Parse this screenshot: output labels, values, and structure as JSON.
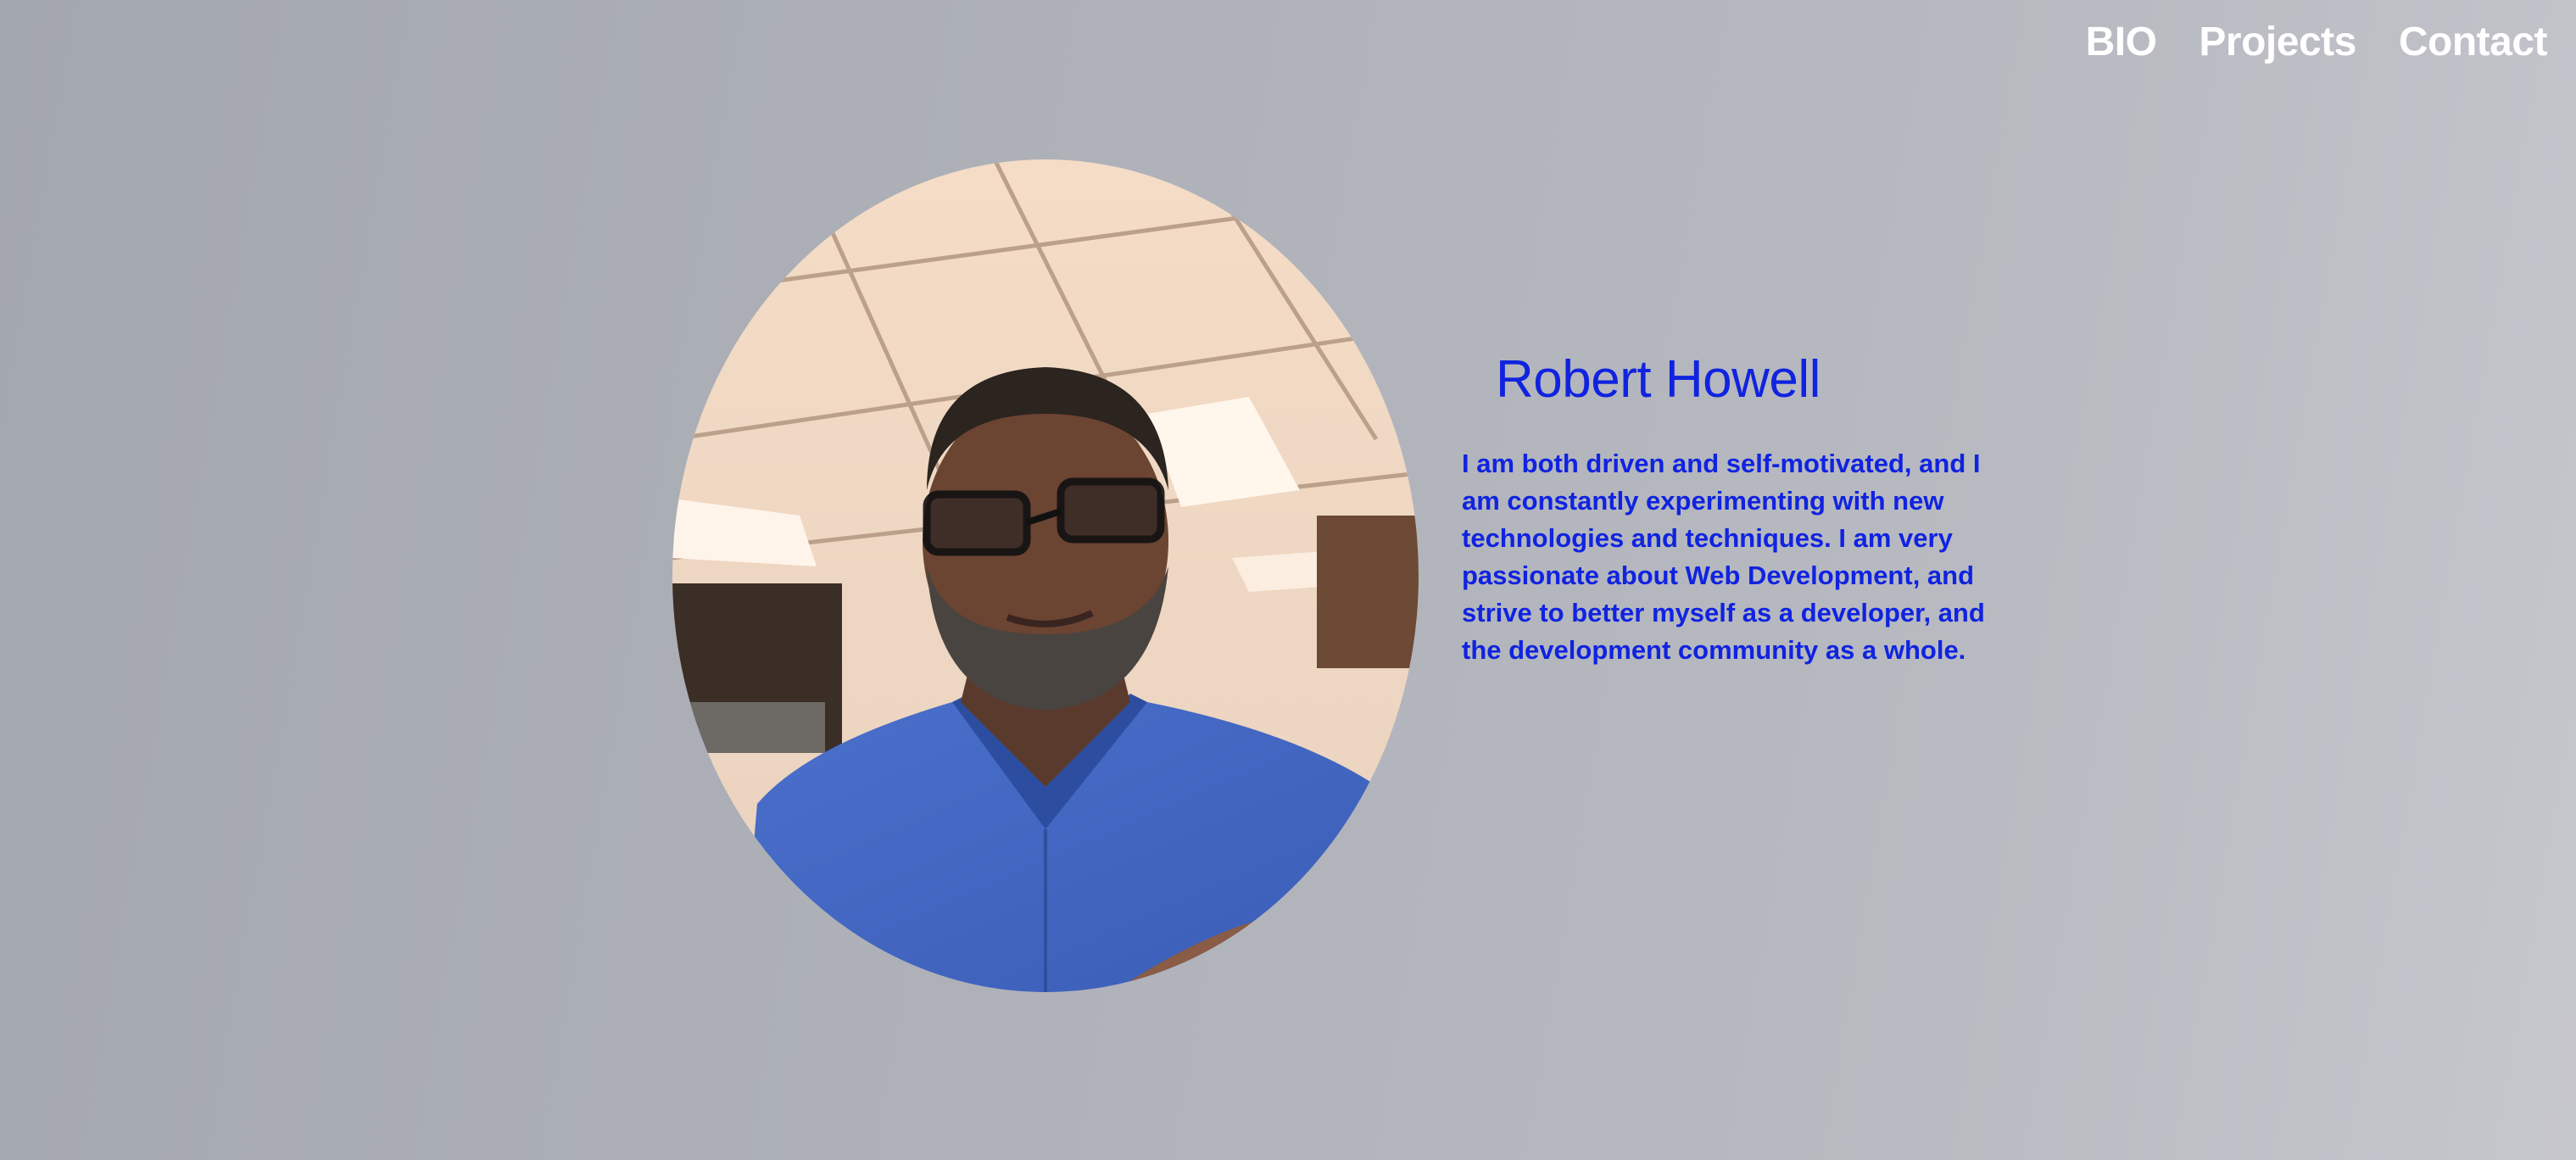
{
  "nav": {
    "items": [
      {
        "label": "BIO"
      },
      {
        "label": "Projects"
      },
      {
        "label": "Contact"
      }
    ]
  },
  "profile": {
    "name": "Robert Howell",
    "bio": "I am both driven and self-motivated, and I am constantly experimenting with new technologies and techniques. I am very passionate about Web Development, and strive to better myself as a developer, and the development community as a whole."
  },
  "colors": {
    "accent": "#1023e0",
    "nav_text": "#ffffff",
    "background": "#aeb1b8"
  }
}
